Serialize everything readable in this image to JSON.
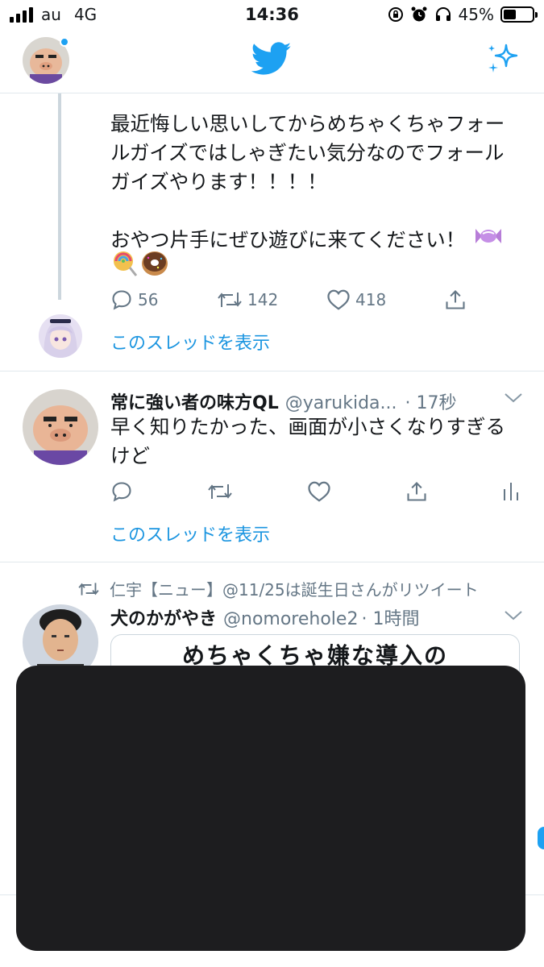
{
  "status_bar": {
    "carrier": "au",
    "network": "4G",
    "time": "14:36",
    "battery_percent": "45%",
    "battery_level": 0.45,
    "icons": [
      "orientation-lock-icon",
      "alarm-icon",
      "headphones-icon"
    ]
  },
  "nav": {
    "logo": "twitter-bird-icon",
    "right_icon": "sparkle-icon",
    "brand_color": "#1da1f2"
  },
  "tweets": [
    {
      "text": "最近悔しい思いしてからめちゃくちゃフォー\nルガイズではしゃぎたい気分なのでフォール\nガイズやります！！！！\n\nおやつ片手にぜひ遊びに来てください！",
      "emoji": [
        "candy",
        "lollipop",
        "doughnut"
      ],
      "reply_count": "56",
      "retweet_count": "142",
      "like_count": "418",
      "show_thread": "このスレッドを表示"
    },
    {
      "name": "常に強い者の味方QL",
      "handle": "@yarukida...",
      "time": "· 17秒",
      "text": "早く知りたかった、画面が小さくなりすぎる\nけど",
      "show_thread": "このスレッドを表示"
    },
    {
      "retweeted_by": "仁宇【ニュー】@11/25は誕生日さんがリツイート",
      "name": "犬のかがやき",
      "handle": "@nomorehole2",
      "time": "· 1時間",
      "card_title": "めちゃくちゃ嫌な導入の"
    }
  ]
}
